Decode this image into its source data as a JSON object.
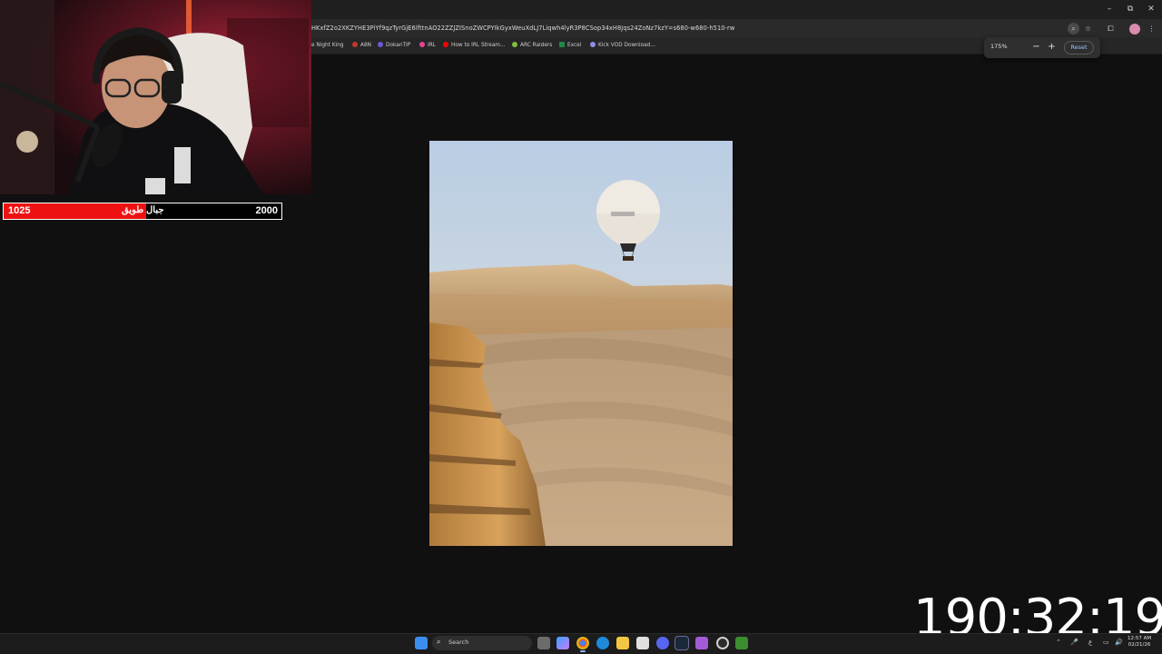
{
  "browser": {
    "url": "HKxfZ2o2XKZYHE3PiYf9qzTyrGjE6lfttnAO22ZZJZISnoZWCPYIkGyxWeuXdLJ7Liqwh4lyR3P8CSop34xH8Jqs24ZoNz7kzY=s680-w680-h510-rw",
    "bookmarks": [
      "e Night King",
      "A8N",
      "DokanTIP",
      "IRL",
      "How to IRL Stream...",
      "ARC Raiders",
      "Excel",
      "Kick VOD Download..."
    ],
    "zoom": {
      "level": "175%",
      "minus": "−",
      "plus": "+",
      "reset_label": "Reset"
    },
    "window_controls": {
      "minimize": "–",
      "restore": "⧉",
      "close": "✕"
    },
    "icons": {
      "zoom": "⌕",
      "star": "☆",
      "extensions": "⧠",
      "menu": "⋮"
    }
  },
  "overlay": {
    "score_left": "1025",
    "score_right": "2000",
    "score_label": "جبال طويق",
    "score_fraction": 0.5125,
    "timer": "190:32:19"
  },
  "taskbar": {
    "search_placeholder": "Search",
    "search_icon": "⌕",
    "clock_time": "12:57 AM",
    "clock_date": "02/21/26",
    "tray": {
      "chevron": "⌃",
      "mic": "🎤",
      "lang": "ع",
      "monitor": "▭",
      "volume": "🔊"
    },
    "apps": [
      "start",
      "widgets",
      "task-view",
      "copilot",
      "chrome",
      "edge",
      "file-explorer",
      "store",
      "discord",
      "steam",
      "app-purple",
      "obs",
      "minecraft"
    ]
  },
  "colors": {
    "score_fill": "#ee1111",
    "page_bg": "#101010",
    "chrome_bg": "#1f1f1f"
  }
}
